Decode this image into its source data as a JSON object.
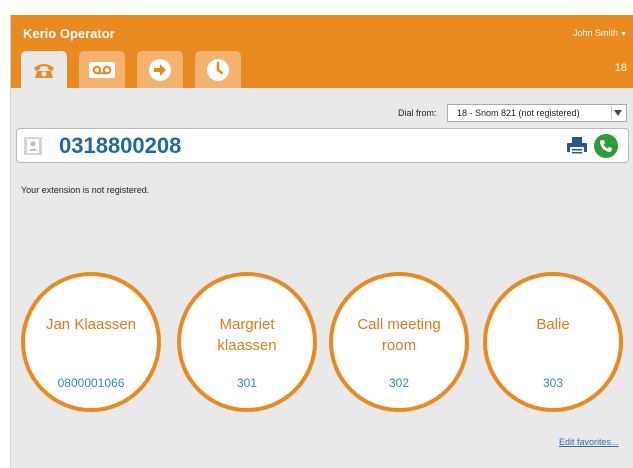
{
  "header": {
    "app_title": "Kerio Operator",
    "user_name": "John Smith",
    "extension": "18"
  },
  "tabs": [
    {
      "name": "phone-icon",
      "active": true
    },
    {
      "name": "voicemail-icon",
      "active": false
    },
    {
      "name": "forward-arrow-icon",
      "active": false
    },
    {
      "name": "clock-icon",
      "active": false
    }
  ],
  "dial": {
    "label": "Dial from:",
    "selected": "18 - Snom 821 (not registered)"
  },
  "number_bar": {
    "value": "0318800208"
  },
  "status": "Your extension is not registered.",
  "favorites": [
    {
      "name": "Jan Klaassen",
      "number": "0800001066"
    },
    {
      "name": "Margriet klaassen",
      "number": "301"
    },
    {
      "name": "Call meeting room",
      "number": "302"
    },
    {
      "name": "Balie",
      "number": "303"
    }
  ],
  "edit_favorites": "Edit favorites...",
  "colors": {
    "accent": "#e88a1f",
    "tab_inactive": "#f3b36e",
    "number_text": "#1f6aa5",
    "call_green": "#2e9b3a",
    "link": "#2a6fb8"
  }
}
